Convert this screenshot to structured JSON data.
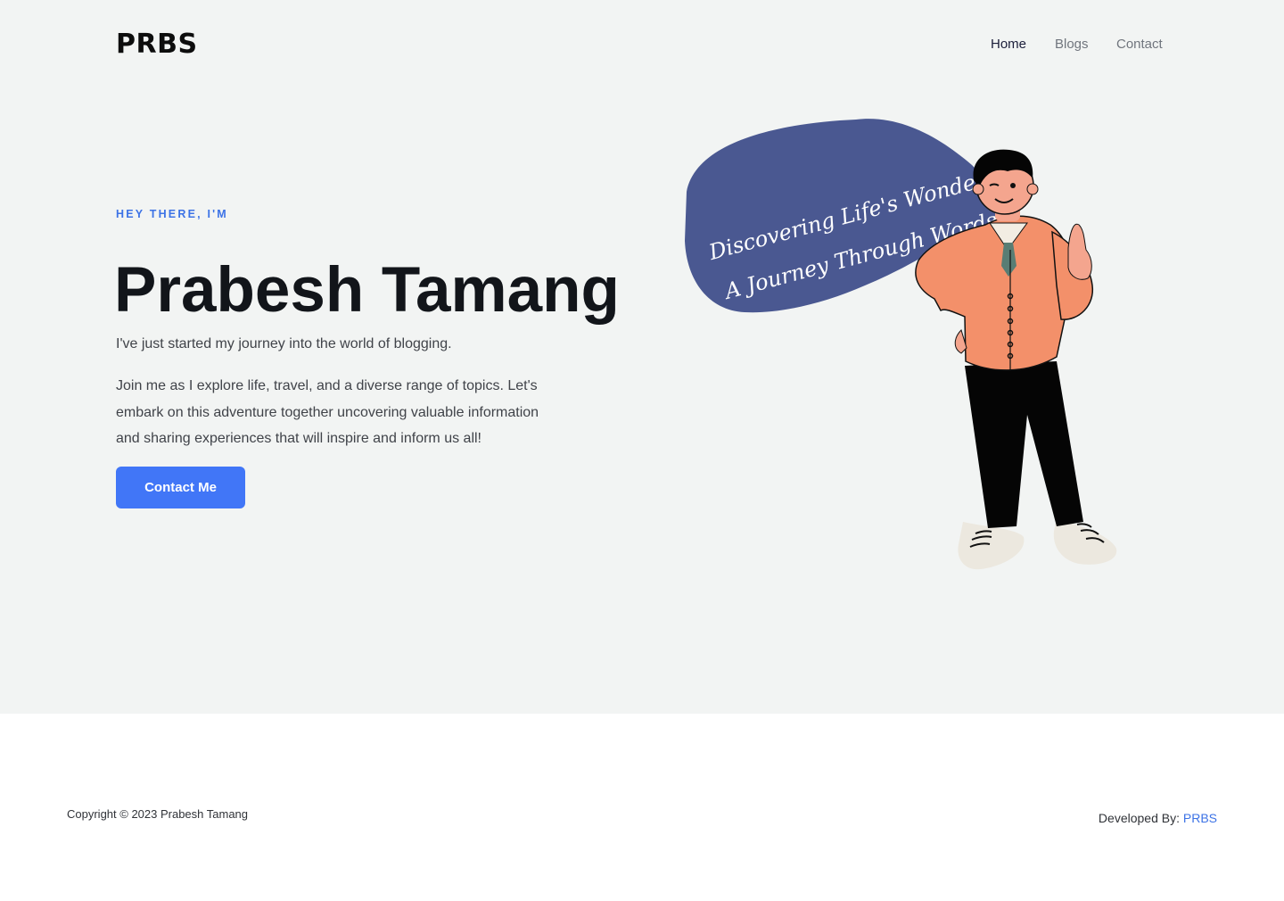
{
  "header": {
    "logo": "PRBS",
    "nav": [
      "Home",
      "Blogs",
      "Contact"
    ],
    "active_nav": "Home"
  },
  "hero": {
    "eyebrow": "HEY THERE, I'M",
    "name": "Prabesh Tamang",
    "subtitle": "I've just started my journey into the world of blogging.",
    "description": "Join me as I explore life, travel, and a diverse range of topics. Let's embark on this adventure together uncovering valuable information and sharing experiences that will inspire and inform us all!",
    "cta_label": "Contact Me"
  },
  "illustration": {
    "bubble_line1": "Discovering Life's Wonders",
    "bubble_line2": "A Journey Through Words"
  },
  "footer": {
    "copyright": "Copyright © 2023 Prabesh Tamang",
    "developed_by_label": "Developed By:",
    "developer_link": "PRBS"
  },
  "colors": {
    "accent": "#4176f7",
    "eyebrow": "#3d73e6",
    "hero_background": "#f2f4f3",
    "bubble": "#4a5891",
    "cardigan": "#f3906a"
  }
}
